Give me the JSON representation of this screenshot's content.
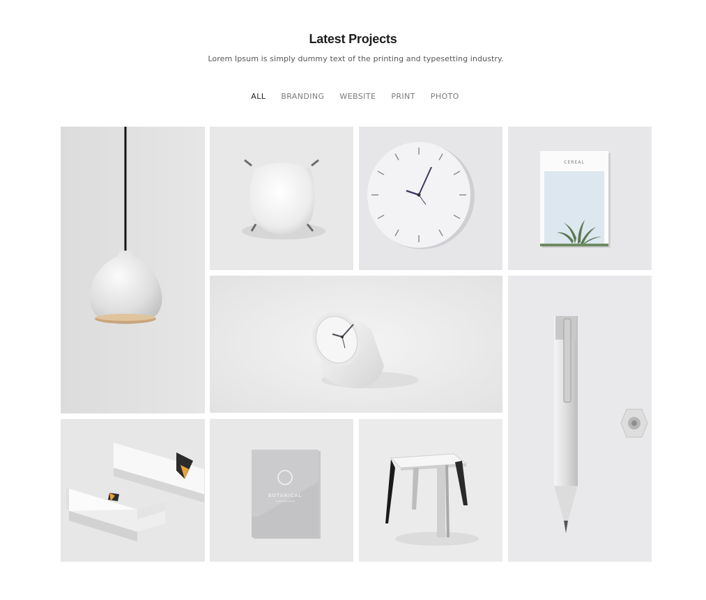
{
  "header": {
    "title": "Latest Projects",
    "subtitle": "Lorem Ipsum is simply dummy text of the printing and typesetting industry."
  },
  "filters": [
    {
      "label": "ALL",
      "active": true
    },
    {
      "label": "BRANDING",
      "active": false
    },
    {
      "label": "WEBSITE",
      "active": false
    },
    {
      "label": "PRINT",
      "active": false
    },
    {
      "label": "PHOTO",
      "active": false
    }
  ],
  "gallery": {
    "items": [
      {
        "name": "pendant-lamp-photo"
      },
      {
        "name": "white-chair-photo"
      },
      {
        "name": "wall-clock-photo"
      },
      {
        "name": "notebook-photo"
      },
      {
        "name": "desk-clock-photo"
      },
      {
        "name": "pencil-photo"
      },
      {
        "name": "business-cards-photo"
      },
      {
        "name": "botanical-booklet-photo"
      },
      {
        "name": "stool-photo"
      }
    ]
  }
}
